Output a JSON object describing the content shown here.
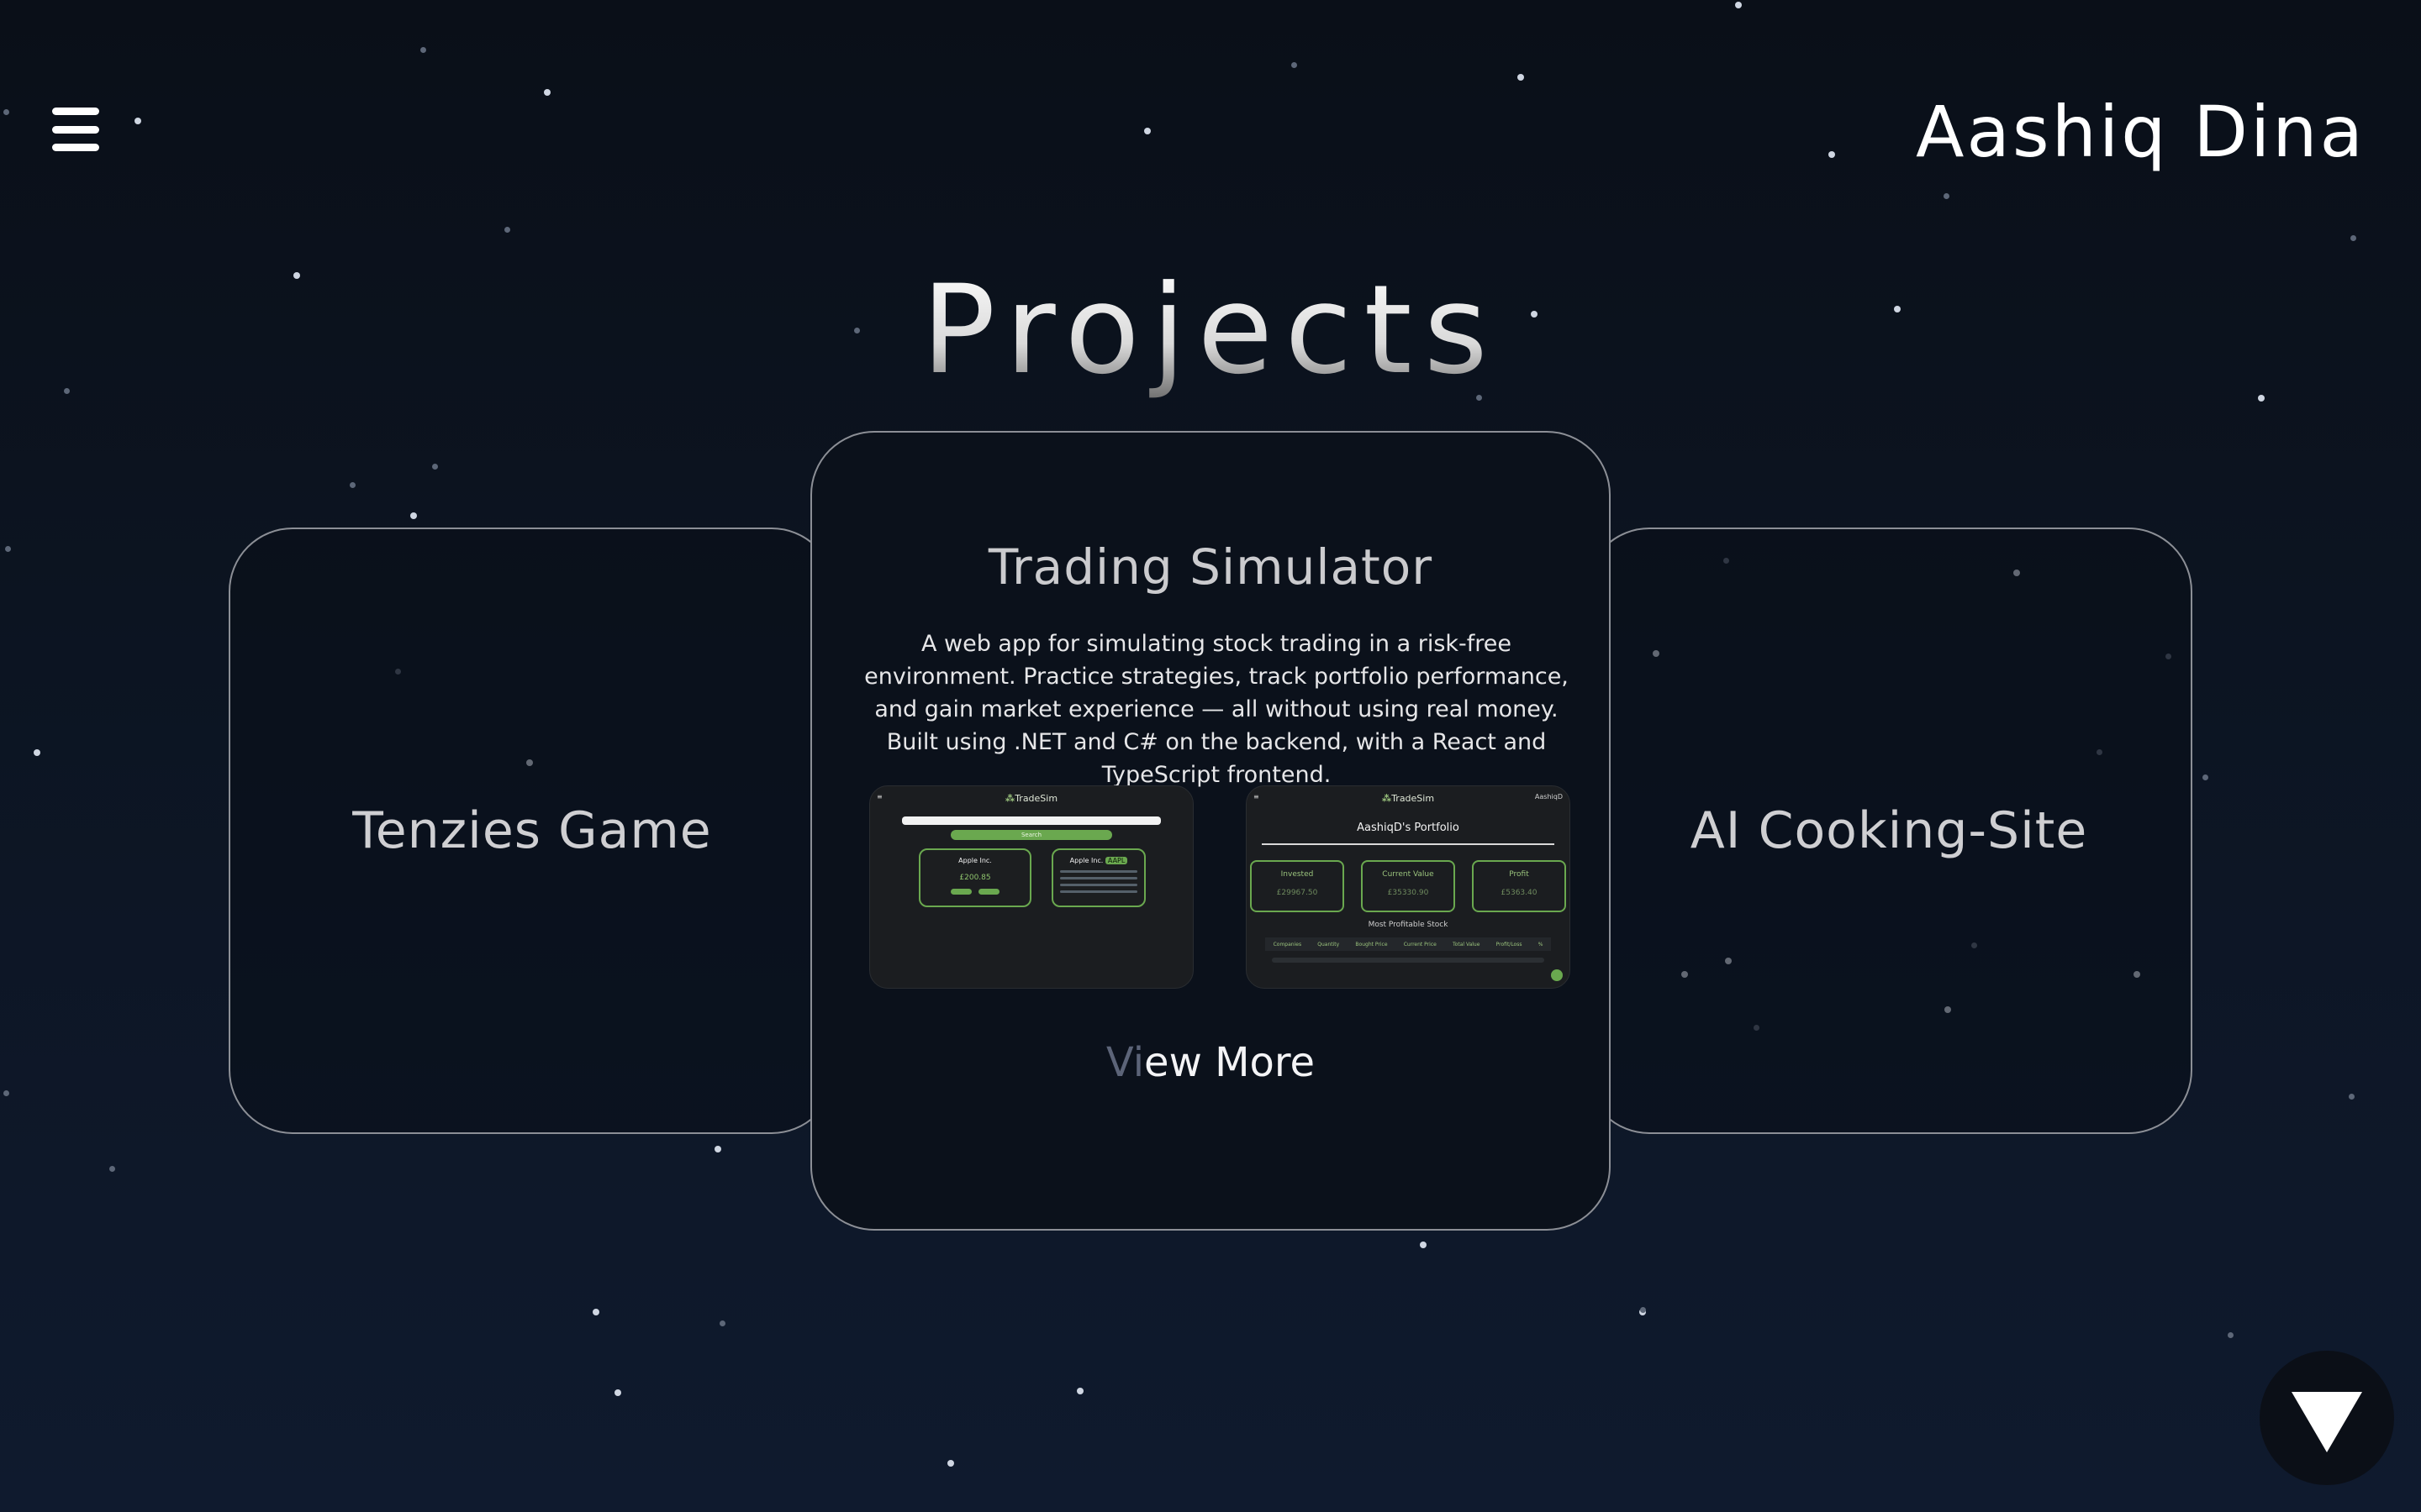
{
  "header": {
    "brand": "Aashiq Dina",
    "menu_icon": "hamburger-menu-icon"
  },
  "page": {
    "title": "Projects"
  },
  "carousel": {
    "left_card": {
      "title": "Tenzies Game"
    },
    "center_card": {
      "title": "Trading Simulator",
      "description": "A web app for simulating stock trading in a risk-free environment. Practice strategies, track portfolio performance, and gain market experience — all without using real money. Built using .NET and C# on the backend, with a React and TypeScript frontend.",
      "view_more": {
        "faded": "Vi",
        "rest": "ew More"
      },
      "screenshot_search": {
        "app_name": "TradeSim",
        "button": "Search",
        "stock_name": "Apple Inc.",
        "stock_price": "£200.85",
        "detail_name": "Apple Inc.",
        "detail_badge": "AAPL"
      },
      "screenshot_portfolio": {
        "app_name": "TradeSim",
        "user": "AashiqD",
        "portfolio_title": "AashiqD's Portfolio",
        "stats": [
          {
            "label": "Invested",
            "value": "£29967.50"
          },
          {
            "label": "Current Value",
            "value": "£35330.90"
          },
          {
            "label": "Profit",
            "value": "£5363.40"
          }
        ],
        "section_title": "Most Profitable Stock",
        "columns": [
          "Companies",
          "Quantity",
          "Bought Price",
          "Current Price",
          "Total Value",
          "Profit/Loss",
          "%"
        ]
      }
    },
    "right_card": {
      "title": "AI Cooking-Site"
    }
  },
  "scroll_button": {
    "icon": "down-triangle-icon"
  },
  "colors": {
    "background_top": "#0a0f18",
    "background_bottom": "#0f1a2e",
    "card_border": "#8c8f96",
    "accent_green": "#6aa84f"
  }
}
